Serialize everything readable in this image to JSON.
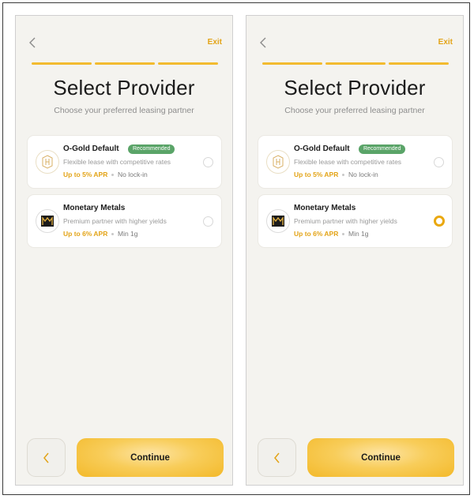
{
  "screens": [
    {
      "exit_label": "Exit",
      "title": "Select Provider",
      "subtitle": "Choose your preferred leasing partner",
      "providers": [
        {
          "name": "O-Gold Default",
          "badge": "Recommended",
          "description": "Flexible lease with competitive rates",
          "apr": "Up to 5% APR",
          "meta": "No lock-in",
          "logo_icon": "ogold-logo",
          "selected": false
        },
        {
          "name": "Monetary Metals",
          "badge": "",
          "description": "Premium partner with higher yields",
          "apr": "Up to 6% APR",
          "meta": "Min 1g",
          "logo_icon": "monetary-metals-logo",
          "selected": false
        }
      ],
      "continue_label": "Continue"
    },
    {
      "exit_label": "Exit",
      "title": "Select Provider",
      "subtitle": "Choose your preferred leasing partner",
      "providers": [
        {
          "name": "O-Gold Default",
          "badge": "Recommended",
          "description": "Flexible lease with competitive rates",
          "apr": "Up to 5% APR",
          "meta": "No lock-in",
          "logo_icon": "ogold-logo",
          "selected": false
        },
        {
          "name": "Monetary Metals",
          "badge": "",
          "description": "Premium partner with higher yields",
          "apr": "Up to 6% APR",
          "meta": "Min 1g",
          "logo_icon": "monetary-metals-logo",
          "selected": true
        }
      ],
      "continue_label": "Continue"
    }
  ],
  "colors": {
    "accent": "#f3b92a",
    "accent_text": "#e3a418",
    "badge_green": "#5aa468",
    "background": "#f4f3ef"
  },
  "icons": {
    "back": "chevron-left-icon",
    "progress_segments": 3
  }
}
